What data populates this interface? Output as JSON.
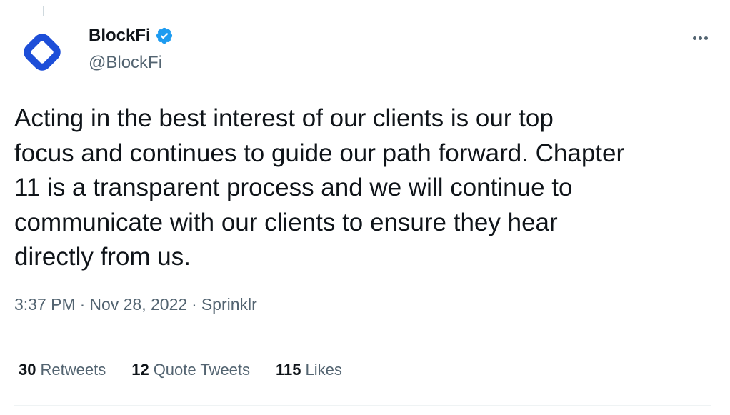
{
  "account": {
    "name": "BlockFi",
    "handle": "@BlockFi"
  },
  "tweet": {
    "text": "Acting in the best interest of our clients is our top\nfocus and continues to guide our path forward. Chapter\n11 is a transparent process and we will continue to\ncommunicate with our clients to ensure they hear\ndirectly from us.",
    "time": "3:37 PM",
    "separator1": "·",
    "date": "Nov 28, 2022",
    "separator2": "·",
    "source": "Sprinklr"
  },
  "stats": {
    "retweets_count": "30",
    "retweets_label": "Retweets",
    "quotes_count": "12",
    "quotes_label": "Quote Tweets",
    "likes_count": "115",
    "likes_label": "Likes"
  },
  "colors": {
    "brand_blue": "#1d4ed8",
    "verified_blue": "#1d9bf0",
    "secondary_text": "#536471"
  },
  "icons": {
    "avatar": "blockfi-logo-icon",
    "verified": "verified-badge-icon",
    "more": "more-dots-icon"
  }
}
